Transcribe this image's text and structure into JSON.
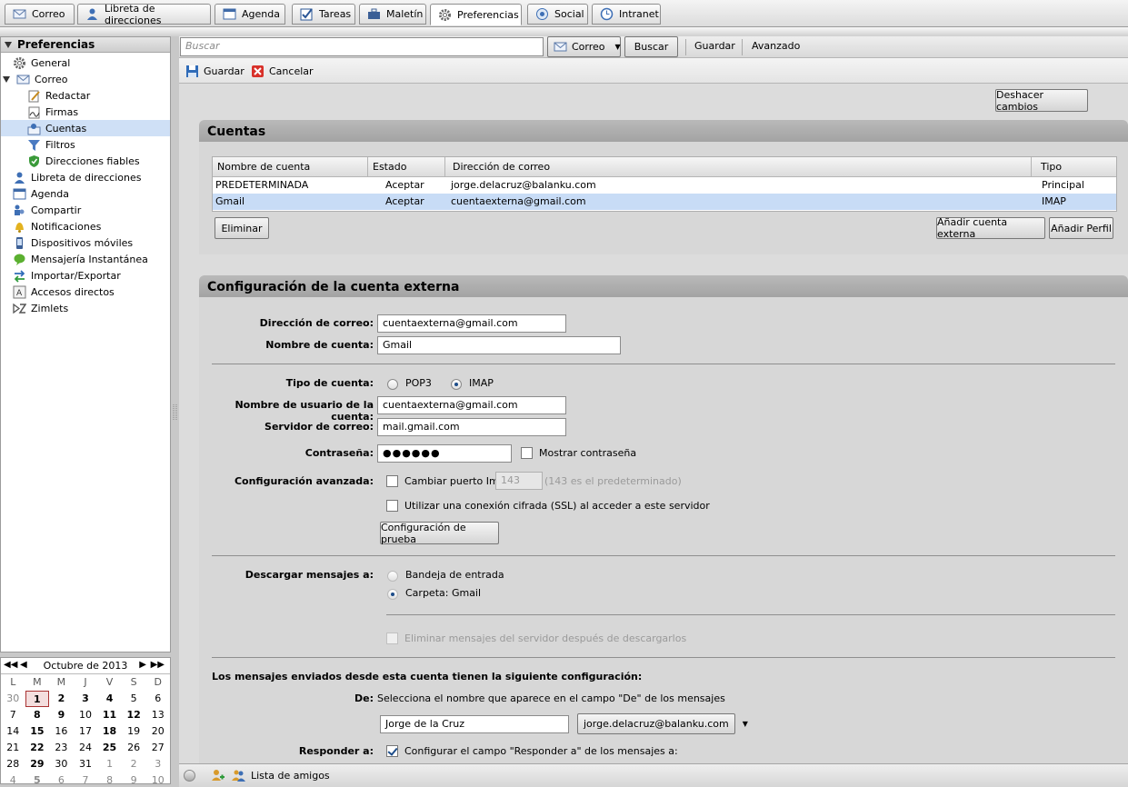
{
  "app_tabs": [
    {
      "label": "Correo",
      "icon": "mail-icon"
    },
    {
      "label": "Libreta de direcciones",
      "icon": "address-book-icon"
    },
    {
      "label": "Agenda",
      "icon": "calendar-icon"
    },
    {
      "label": "Tareas",
      "icon": "tasks-icon"
    },
    {
      "label": "Maletín",
      "icon": "briefcase-icon"
    },
    {
      "label": "Preferencias",
      "icon": "gear-icon"
    },
    {
      "label": "Social",
      "icon": "social-icon"
    },
    {
      "label": "Intranet",
      "icon": "clock-icon"
    }
  ],
  "sidebar": {
    "title": "Preferencias",
    "items": [
      {
        "label": "General",
        "icon": "gear-icon"
      },
      {
        "label": "Correo",
        "icon": "mail-icon"
      },
      {
        "label": "Redactar",
        "icon": "compose-icon"
      },
      {
        "label": "Firmas",
        "icon": "signature-icon"
      },
      {
        "label": "Cuentas",
        "icon": "accounts-icon",
        "selected": true
      },
      {
        "label": "Filtros",
        "icon": "filter-icon"
      },
      {
        "label": "Direcciones fiables",
        "icon": "shield-icon"
      },
      {
        "label": "Libreta de direcciones",
        "icon": "address-book-icon"
      },
      {
        "label": "Agenda",
        "icon": "calendar-icon"
      },
      {
        "label": "Compartir",
        "icon": "share-icon"
      },
      {
        "label": "Notificaciones",
        "icon": "bell-icon"
      },
      {
        "label": "Dispositivos móviles",
        "icon": "mobile-icon"
      },
      {
        "label": "Mensajería Instantánea",
        "icon": "chat-icon"
      },
      {
        "label": "Importar/Exportar",
        "icon": "import-export-icon"
      },
      {
        "label": "Accesos directos",
        "icon": "shortcut-icon"
      },
      {
        "label": "Zimlets",
        "icon": "zimlet-icon"
      }
    ]
  },
  "calendar": {
    "month": "Octubre de 2013",
    "day_headers": [
      "L",
      "M",
      "M",
      "J",
      "V",
      "S",
      "D"
    ],
    "weeks": [
      [
        "30",
        "1",
        "2",
        "3",
        "4",
        "5",
        "6"
      ],
      [
        "7",
        "8",
        "9",
        "10",
        "11",
        "12",
        "13"
      ],
      [
        "14",
        "15",
        "16",
        "17",
        "18",
        "19",
        "20"
      ],
      [
        "21",
        "22",
        "23",
        "24",
        "25",
        "26",
        "27"
      ],
      [
        "28",
        "29",
        "30",
        "31",
        "1",
        "2",
        "3"
      ],
      [
        "4",
        "5",
        "6",
        "7",
        "8",
        "9",
        "10"
      ]
    ]
  },
  "toolbar": {
    "search_placeholder": "Buscar",
    "search_scope": "Correo",
    "search_button": "Buscar",
    "save": "Guardar",
    "advanced": "Avanzado"
  },
  "actions": {
    "save": "Guardar",
    "cancel": "Cancelar",
    "undo_changes": "Deshacer cambios"
  },
  "accounts": {
    "title": "Cuentas",
    "columns": [
      "Nombre de cuenta",
      "Estado",
      "Dirección de correo",
      "Tipo"
    ],
    "rows": [
      {
        "name": "PREDETERMINADA",
        "status": "Aceptar",
        "email": "jorge.delacruz@balanku.com",
        "type": "Principal"
      },
      {
        "name": "Gmail",
        "status": "Aceptar",
        "email": "cuentaexterna@gmail.com",
        "type": "IMAP"
      }
    ],
    "delete_button": "Eliminar",
    "add_external_button": "Añadir cuenta externa",
    "add_profile_button": "Añadir Perfil"
  },
  "external": {
    "title": "Configuración de la cuenta externa",
    "email_label": "Dirección de correo:",
    "email_value": "cuentaexterna@gmail.com",
    "account_name_label": "Nombre de cuenta:",
    "account_name_value": "Gmail",
    "account_type_label": "Tipo de cuenta:",
    "pop3": "POP3",
    "imap": "IMAP",
    "username_label": "Nombre de usuario de la cuenta:",
    "username_value": "cuentaexterna@gmail.com",
    "server_label": "Servidor de correo:",
    "server_value": "mail.gmail.com",
    "password_label": "Contraseña:",
    "password_value": "●●●●●●",
    "show_password": "Mostrar contraseña",
    "advanced_label": "Configuración avanzada:",
    "change_port": "Cambiar puerto Imap",
    "port_value": "143",
    "port_default": "(143 es el predeterminado)",
    "ssl": "Utilizar una conexión cifrada (SSL) al acceder a este servidor",
    "test_button": "Configuración de prueba",
    "download_label": "Descargar mensajes a:",
    "inbox": "Bandeja de entrada",
    "folder": "Carpeta: Gmail",
    "delete_server": "Eliminar mensajes del servidor después de descargarlos",
    "sent_settings": "Los mensajes enviados desde esta cuenta tienen la siguiente configuración:",
    "from_label": "De:",
    "from_hint": "Selecciona el nombre que aparece en el campo \"De\" de los mensajes",
    "from_name": "Jorge de la Cruz",
    "from_address": "jorge.delacruz@balanku.com",
    "reply_label": "Responder a:",
    "reply_hint": "Configurar el campo \"Responder a\" de los mensajes a:"
  },
  "status_bar": {
    "buddy_list": "Lista de amigos"
  }
}
